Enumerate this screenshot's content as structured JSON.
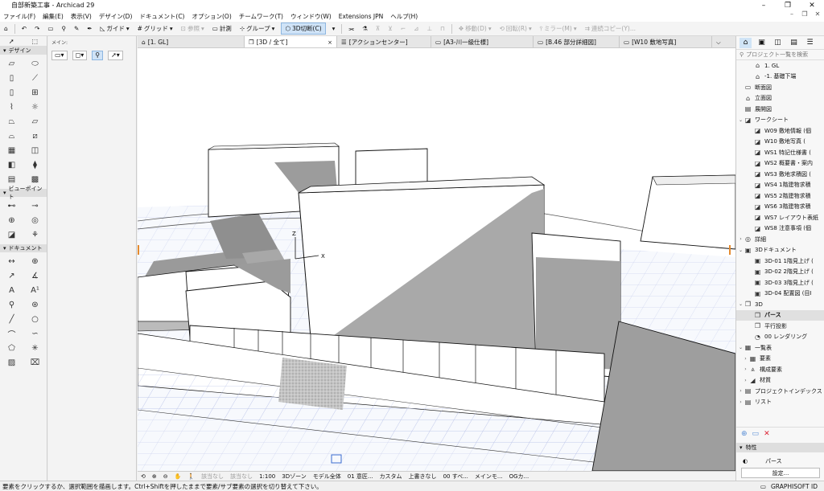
{
  "window": {
    "title": "自部新築工事 - Archicad 29",
    "min": "–",
    "max": "❐",
    "close": "✕"
  },
  "menu": [
    "ファイル(F)",
    "編集(E)",
    "表示(V)",
    "デザイン(D)",
    "ドキュメント(C)",
    "オプション(O)",
    "チームワーク(T)",
    "ウィンドウ(W)",
    "Extensions JPN",
    "ヘルプ(H)"
  ],
  "mdi": [
    "–",
    "❐",
    "✕"
  ],
  "toolbar": {
    "guide": "ガイド",
    "grid": "グリッド",
    "ref": "参照",
    "measure": "計測",
    "group": "グループ",
    "section3d": "3D切断(C)",
    "move": "移動(D)",
    "rotate": "回転(R)",
    "mirror": "ミラー(M)",
    "multiply": "連続コピー(Y)..."
  },
  "leftpanel": {
    "sections": [
      "デザイン",
      "ビューポイント",
      "ドキュメント"
    ]
  },
  "infobox": {
    "label": "メイン:"
  },
  "tabs": [
    {
      "icon": "⌂",
      "label": "[1. GL]"
    },
    {
      "icon": "❒",
      "label": "[3D / 全て]",
      "close": "×"
    },
    {
      "icon": "☰",
      "label": "[アクションセンター]"
    },
    {
      "icon": "▭",
      "label": "[A3-川一級仕様]"
    },
    {
      "icon": "▭",
      "label": "[B.46 部分詳細図]"
    },
    {
      "icon": "▭",
      "label": "[W10 敷地写真]"
    }
  ],
  "viewport": {
    "axis_z": "Z",
    "axis_x": "X"
  },
  "navbar": {
    "none1": "該当なし",
    "none2": "該当なし",
    "scale": "1:100",
    "zone": "3Dゾーン",
    "model": "モデル全体",
    "view": "01 意匠...",
    "custom": "カスタム",
    "upper": "上書きなし",
    "all": "00 すべ...",
    "memo": "メインモ...",
    "og": "OGカ..."
  },
  "rightpanel": {
    "search": "プロジェクト一覧を検索",
    "tree": [
      {
        "label": "1. GL",
        "icon": "⌂",
        "indent": 3,
        "ex": ""
      },
      {
        "label": "-1. 基礎下端",
        "icon": "⌂",
        "indent": 3,
        "ex": ""
      },
      {
        "label": "断面図",
        "icon": "▭",
        "indent": 1,
        "ex": ""
      },
      {
        "label": "立面図",
        "icon": "⌂",
        "indent": 1,
        "ex": ""
      },
      {
        "label": "展開図",
        "icon": "▤",
        "indent": 1,
        "ex": ""
      },
      {
        "label": "ワークシート",
        "icon": "◪",
        "indent": 1,
        "ex": "⌄"
      },
      {
        "label": "W09 敷地情報 (個",
        "icon": "◪",
        "indent": 3,
        "ex": ""
      },
      {
        "label": "W10 敷地写真 (",
        "icon": "◪",
        "indent": 3,
        "ex": ""
      },
      {
        "label": "WS1 特記仕様書 (",
        "icon": "◪",
        "indent": 3,
        "ex": ""
      },
      {
        "label": "WS2 概要書・案内",
        "icon": "◪",
        "indent": 3,
        "ex": ""
      },
      {
        "label": "WS3 敷地求積図 (",
        "icon": "◪",
        "indent": 3,
        "ex": ""
      },
      {
        "label": "WS4 1階建物求積",
        "icon": "◪",
        "indent": 3,
        "ex": ""
      },
      {
        "label": "WS5 2階建物求積",
        "icon": "◪",
        "indent": 3,
        "ex": ""
      },
      {
        "label": "WS6 3階建物求積",
        "icon": "◪",
        "indent": 3,
        "ex": ""
      },
      {
        "label": "WS7 レイアウト表紙",
        "icon": "◪",
        "indent": 3,
        "ex": ""
      },
      {
        "label": "WS8 注意事項 (個",
        "icon": "◪",
        "indent": 3,
        "ex": ""
      },
      {
        "label": "詳細",
        "icon": "◎",
        "indent": 1,
        "ex": "›"
      },
      {
        "label": "3Dドキュメント",
        "icon": "▣",
        "indent": 1,
        "ex": "⌄"
      },
      {
        "label": "3D-01 1階見上げ (",
        "icon": "▣",
        "indent": 3,
        "ex": ""
      },
      {
        "label": "3D-02 2階見上げ (",
        "icon": "▣",
        "indent": 3,
        "ex": ""
      },
      {
        "label": "3D-03 3階見上げ (",
        "icon": "▣",
        "indent": 3,
        "ex": ""
      },
      {
        "label": "3D-04 配置図 (目I",
        "icon": "▣",
        "indent": 3,
        "ex": ""
      },
      {
        "label": "3D",
        "icon": "❒",
        "indent": 1,
        "ex": "⌄"
      },
      {
        "label": "パース",
        "icon": "❒",
        "indent": 3,
        "ex": "",
        "selected": true
      },
      {
        "label": "平行投影",
        "icon": "❒",
        "indent": 3,
        "ex": ""
      },
      {
        "label": "00 レンダリング",
        "icon": "◔",
        "indent": 3,
        "ex": ""
      },
      {
        "label": "一覧表",
        "icon": "▦",
        "indent": 1,
        "ex": "⌄"
      },
      {
        "label": "要素",
        "icon": "▦",
        "indent": 2,
        "ex": "›"
      },
      {
        "label": "構成要素",
        "icon": "⩓",
        "indent": 2,
        "ex": "›"
      },
      {
        "label": "材質",
        "icon": "◢",
        "indent": 2,
        "ex": "›"
      },
      {
        "label": "プロジェクトインデックス",
        "icon": "▤",
        "indent": 1,
        "ex": "›"
      },
      {
        "label": "リスト",
        "icon": "▤",
        "indent": 1,
        "ex": "›"
      }
    ],
    "props_header": "特性",
    "props_value": "パース",
    "settings": "設定..."
  },
  "statusbar": {
    "hint": "要素をクリックするか、選択範囲を描画します。Ctrl+Shiftを押したままで要素/サブ要素の選択を切り替えて下さい。",
    "brand": "GRAPHISOFT ID"
  }
}
